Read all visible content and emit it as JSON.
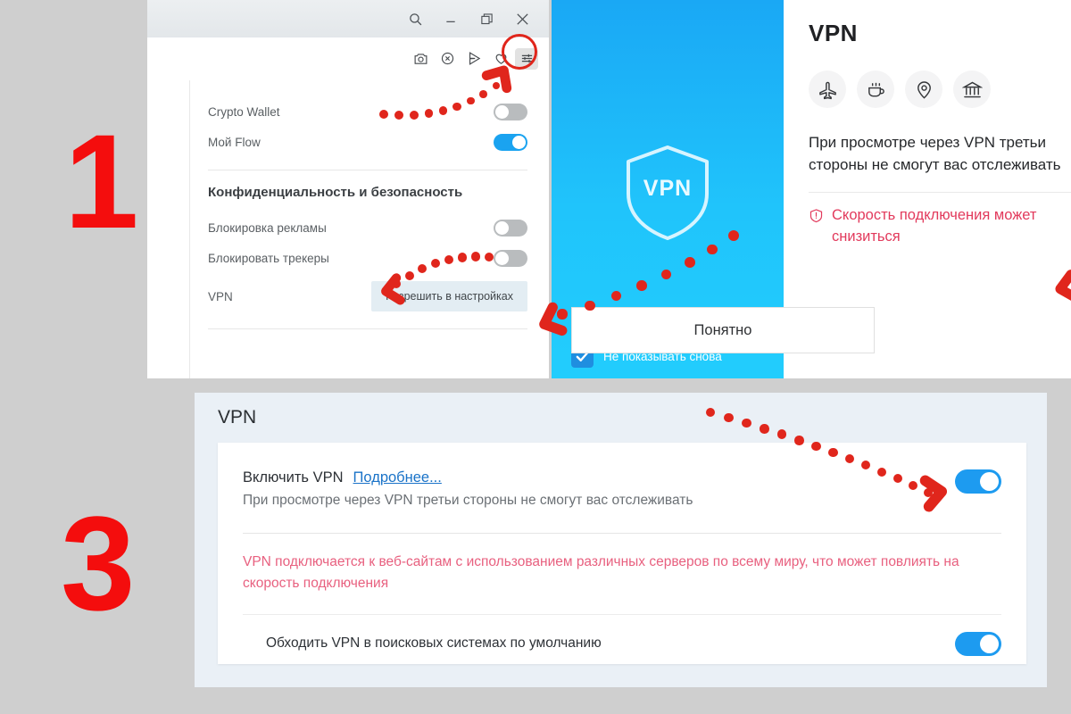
{
  "steps": {
    "one": "1",
    "three": "3"
  },
  "panel1": {
    "titlebar_icons": [
      "search-icon",
      "minimize-icon",
      "restore-icon",
      "close-icon"
    ],
    "toolbar_icons": [
      "camera-icon",
      "shield-off-icon",
      "send-icon",
      "heart-icon",
      "settings-sliders-icon"
    ],
    "rows": [
      {
        "label": "Crypto Wallet",
        "toggle": "off"
      },
      {
        "label": "Мой Flow",
        "toggle": "on"
      }
    ],
    "section_title": "Конфиденциальность и безопасность",
    "privacy_rows": [
      {
        "label": "Блокировка рекламы",
        "toggle": "off"
      },
      {
        "label": "Блокировать трекеры",
        "toggle": "off"
      }
    ],
    "vpn_row": {
      "label": "VPN",
      "button": "Разрешить в настройках"
    }
  },
  "panel2": {
    "shield_text": "VPN",
    "checkbox": {
      "label": "Не показывать снова",
      "checked": true
    },
    "title": "VPN",
    "feature_icons": [
      "airplane-icon",
      "coffee-cup-icon",
      "location-pin-icon",
      "bank-icon"
    ],
    "description": "При просмотре через VPN третьи стороны не смогут вас отслеживать",
    "warning": "Скорость подключения может снизиться",
    "button": "Понятно"
  },
  "panel3": {
    "title": "VPN",
    "enable_label": "Включить VPN",
    "learn_more": "Подробнее...",
    "subtitle": "При просмотре через VPN третьи стороны не смогут вас отслеживать",
    "enable_toggle": "on",
    "warning": "VPN подключается к веб-сайтам с использованием различных серверов по всему миру, что может повлиять на скорость подключения",
    "bypass_label": "Обходить VPN в поисковых системах по умолчанию",
    "bypass_toggle": "on"
  },
  "colors": {
    "accent_red": "#e0261c",
    "toggle_blue": "#1d9bf0",
    "warning_pink": "#e8607f",
    "link_blue": "#1a73c8",
    "page_bg": "#cfcfcf"
  }
}
